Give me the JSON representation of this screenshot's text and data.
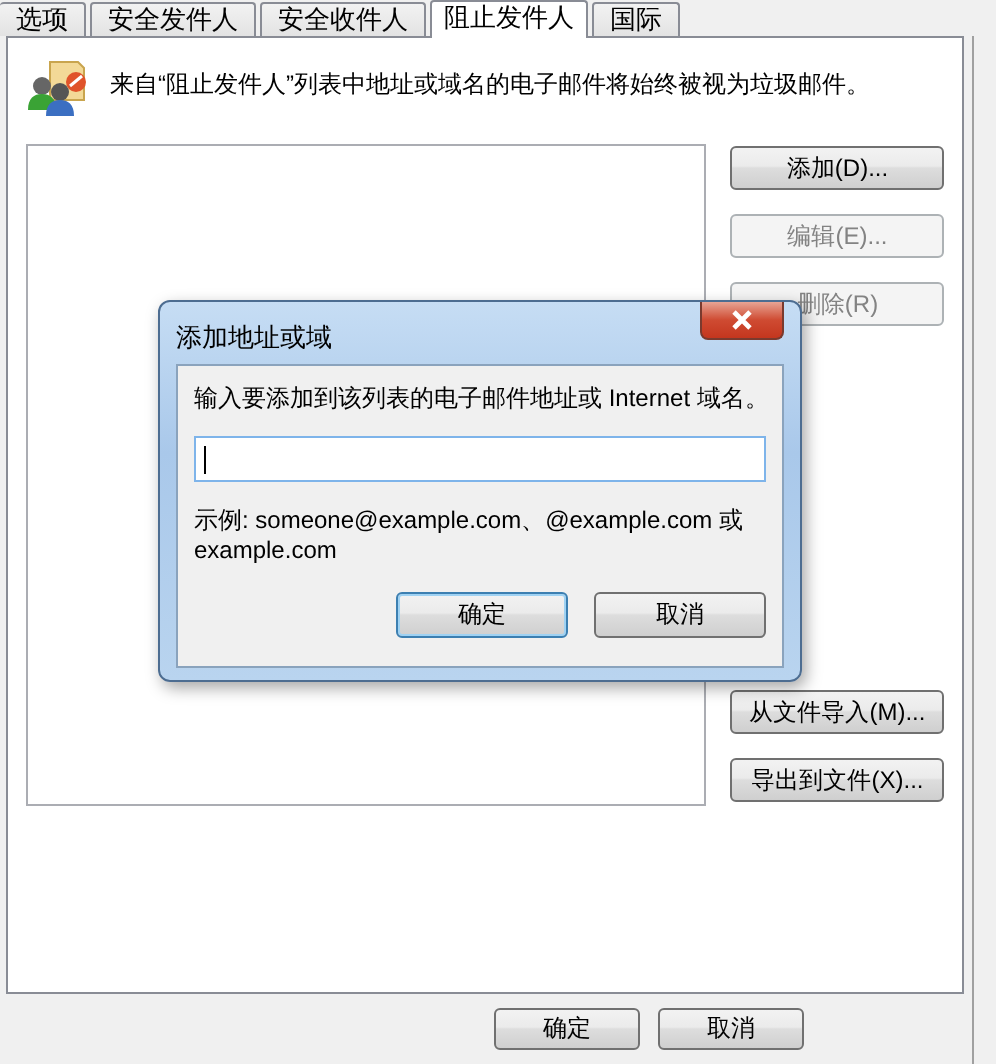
{
  "tabs": [
    {
      "label": "选项",
      "selected": false
    },
    {
      "label": "安全发件人",
      "selected": false
    },
    {
      "label": "安全收件人",
      "selected": false
    },
    {
      "label": "阻止发件人",
      "selected": true
    },
    {
      "label": "国际",
      "selected": false
    }
  ],
  "description": "来自“阻止发件人”列表中地址或域名的电子邮件将始终被视为垃圾邮件。",
  "side_buttons": [
    {
      "label": "添加(D)...",
      "disabled": false
    },
    {
      "label": "编辑(E)...",
      "disabled": true
    },
    {
      "label": "删除(R)",
      "disabled": true
    },
    {
      "label": "从文件导入(M)...",
      "disabled": false
    },
    {
      "label": "导出到文件(X)...",
      "disabled": false
    }
  ],
  "bottom_buttons": [
    {
      "label": "确定"
    },
    {
      "label": "取消"
    }
  ],
  "modal": {
    "title": "添加地址或域",
    "prompt": "输入要添加到该列表的电子邮件地址或 Internet 域名。",
    "example": "示例: someone@example.com、@example.com 或 example.com",
    "buttons": [
      {
        "label": "确定",
        "default": true
      },
      {
        "label": "取消",
        "default": false
      }
    ]
  }
}
